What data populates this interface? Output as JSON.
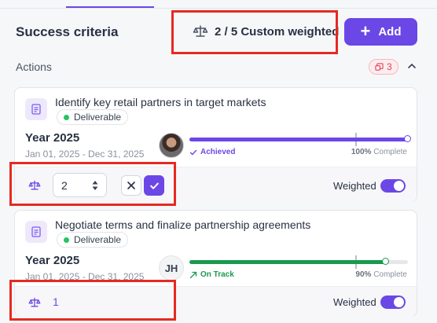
{
  "header": {
    "title": "Success criteria",
    "weight_summary": "2 / 5 Custom weighted",
    "add_label": "Add"
  },
  "actions": {
    "label": "Actions",
    "count": "3"
  },
  "cards": [
    {
      "title": "Identify key retail partners in target markets",
      "type": "Deliverable",
      "period": "Year 2025",
      "dates": "Jan 01, 2025 - Dec 31, 2025",
      "avatar": "photo",
      "status": "Achieved",
      "status_color": "#6b47e6",
      "progress": 100,
      "target": 76,
      "complete_value": "100%",
      "complete_label": "Complete",
      "weight_value": "2",
      "weighted_label": "Weighted",
      "weighted_on": true
    },
    {
      "title": "Negotiate terms and finalize partnership agreements",
      "type": "Deliverable",
      "period": "Year 2025",
      "dates": "Jan 01, 2025 - Dec 31, 2025",
      "avatar_initials": "JH",
      "status": "On Track",
      "status_color": "#1a9a4f",
      "progress": 90,
      "target": 76,
      "complete_value": "90%",
      "complete_label": "Complete",
      "weight_value": "1",
      "weighted_label": "Weighted",
      "weighted_on": true
    }
  ],
  "colors": {
    "accent": "#6b47e6",
    "success": "#1a9a4f",
    "danger_badge": "#e0405a",
    "annotation_box": "#e52a21"
  },
  "icons": [
    "scale-icon",
    "plus-icon",
    "comment-icon",
    "chevron-up-icon",
    "document-icon",
    "check-icon",
    "trend-up-icon",
    "close-icon",
    "stepper-arrows-icon"
  ]
}
